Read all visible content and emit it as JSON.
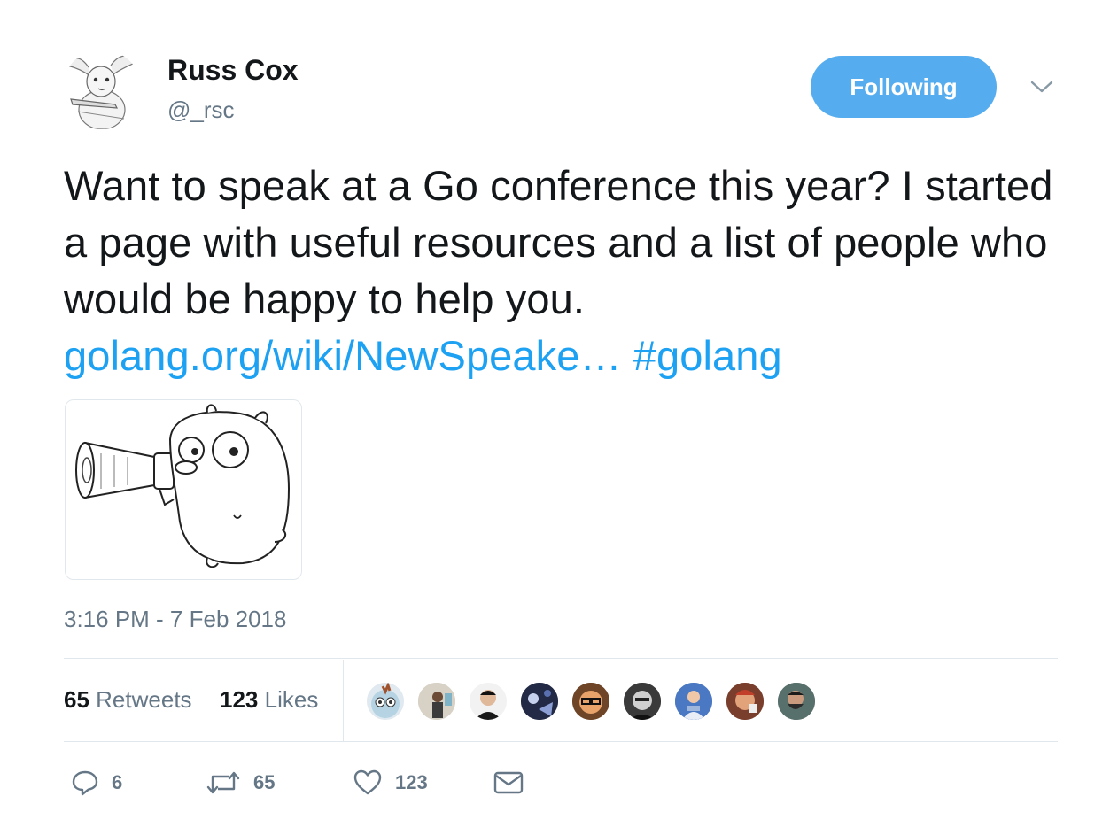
{
  "author": {
    "name": "Russ Cox",
    "handle": "@_rsc",
    "avatar_icon": "bunny-avatar-icon"
  },
  "follow_button": {
    "label": "Following",
    "color": "#55acee"
  },
  "tweet": {
    "text": "Want to speak at a Go conference this year? I started a page with useful resources and a list of people who would be happy to help you.",
    "link_text": "golang.org/wiki/NewSpeake…",
    "hashtag": "#golang",
    "link_color": "#1da1f2",
    "media_icon": "gopher-megaphone-icon",
    "timestamp": "3:16 PM - 7 Feb 2018"
  },
  "stats": {
    "retweets_count": "65",
    "retweets_label": "Retweets",
    "likes_count": "123",
    "likes_label": "Likes",
    "liker_avatars": 9
  },
  "actions": {
    "reply_count": "6",
    "retweet_count": "65",
    "like_count": "123",
    "icons": [
      "reply-icon",
      "retweet-icon",
      "like-icon",
      "message-icon"
    ]
  }
}
